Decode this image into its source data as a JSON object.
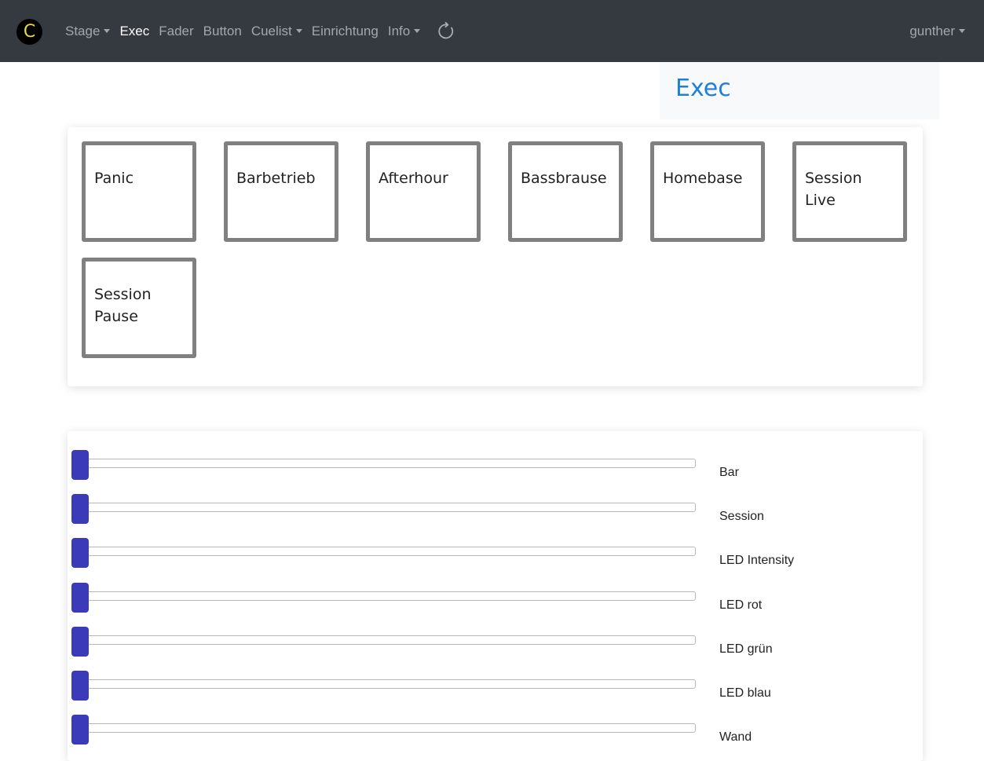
{
  "brand": {
    "logo_letter": "C",
    "logo_color": "#e8d646"
  },
  "nav": {
    "items": [
      {
        "label": "Stage",
        "dropdown": true,
        "active": false
      },
      {
        "label": "Exec",
        "dropdown": false,
        "active": true
      },
      {
        "label": "Fader",
        "dropdown": false,
        "active": false
      },
      {
        "label": "Button",
        "dropdown": false,
        "active": false
      },
      {
        "label": "Cuelist",
        "dropdown": true,
        "active": false
      },
      {
        "label": "Einrichtung",
        "dropdown": false,
        "active": false
      },
      {
        "label": "Info",
        "dropdown": true,
        "active": false
      }
    ],
    "refresh_icon": "refresh-icon",
    "user_label": "gunther"
  },
  "page": {
    "title": "Exec"
  },
  "exec_buttons": [
    {
      "label": "Panic"
    },
    {
      "label": "Barbetrieb"
    },
    {
      "label": "Afterhour"
    },
    {
      "label": "Bassbrause"
    },
    {
      "label": "Homebase"
    },
    {
      "label": "Session Live"
    },
    {
      "label": "Session Pause"
    }
  ],
  "faders": [
    {
      "label": "Bar",
      "value": 0
    },
    {
      "label": "Session",
      "value": 0
    },
    {
      "label": "LED Intensity",
      "value": 0
    },
    {
      "label": "LED rot",
      "value": 0
    },
    {
      "label": "LED grün",
      "value": 0
    },
    {
      "label": "LED blau",
      "value": 0
    },
    {
      "label": "Wand",
      "value": 0
    }
  ],
  "colors": {
    "navbar_bg": "#343a40",
    "title": "#1f7fd9",
    "fader_handle": "#3b3ab8",
    "exec_border": "#808080"
  }
}
